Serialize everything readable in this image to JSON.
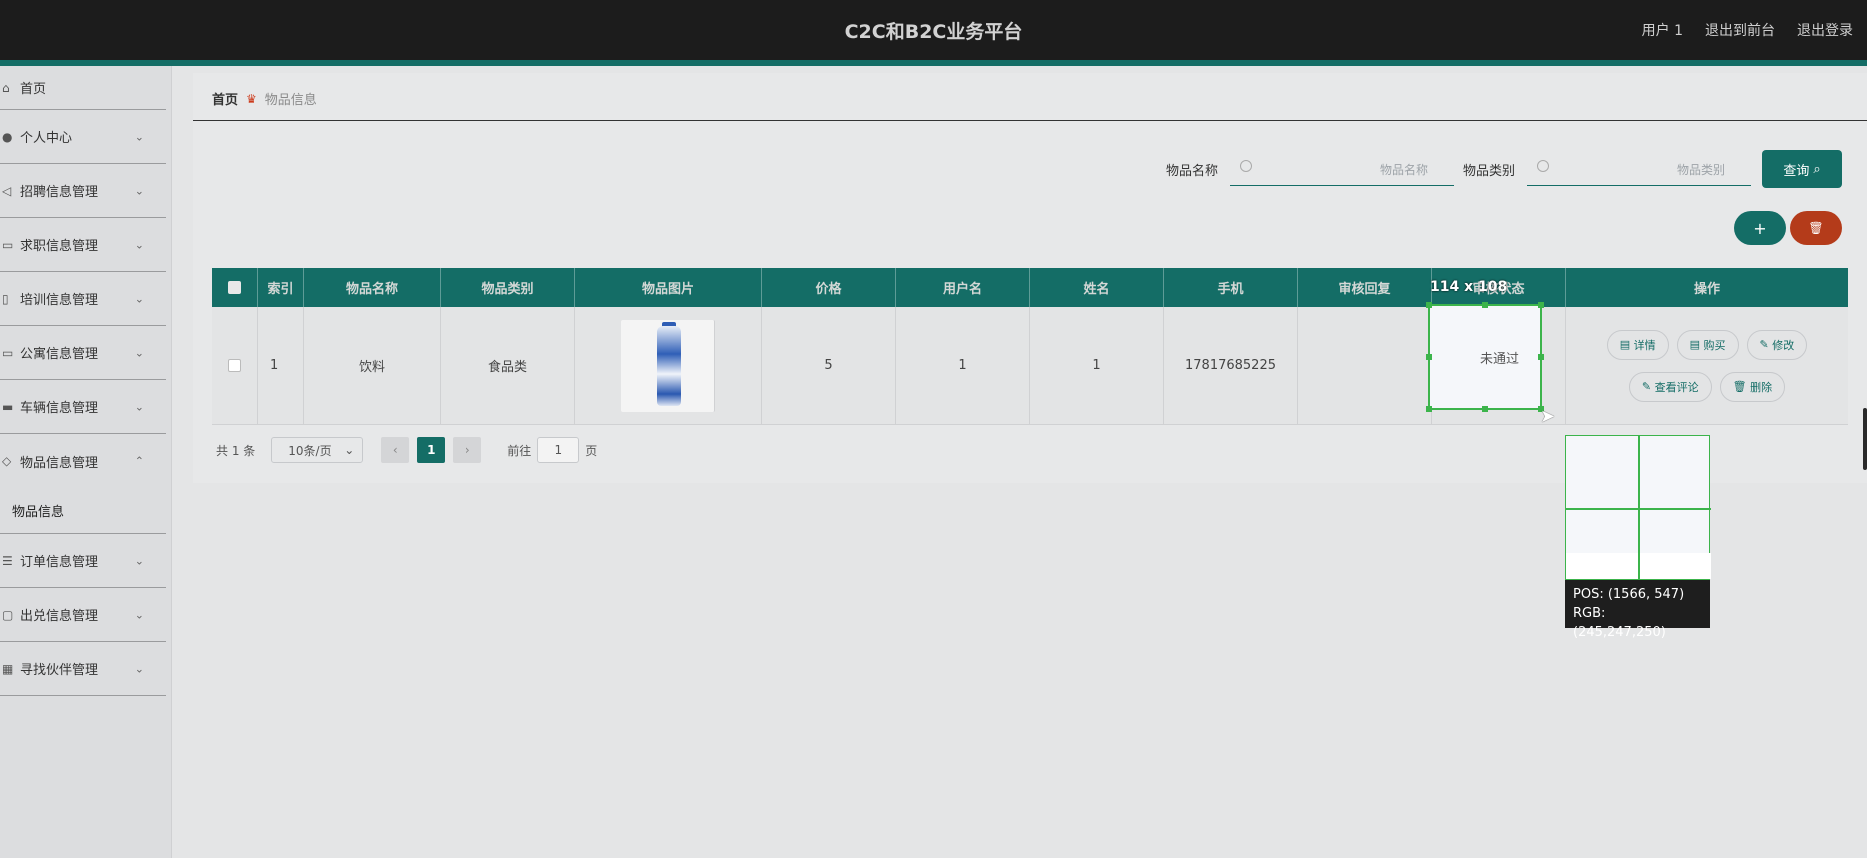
{
  "header": {
    "title": "C2C和B2C业务平台",
    "user": "用户 1",
    "to_front": "退出到前台",
    "logout": "退出登录"
  },
  "sidebar": {
    "items": [
      {
        "label": "首页",
        "icon": "home-icon"
      },
      {
        "label": "个人中心",
        "icon": "user-icon"
      },
      {
        "label": "招聘信息管理",
        "icon": "send-icon"
      },
      {
        "label": "求职信息管理",
        "icon": "folder-icon"
      },
      {
        "label": "培训信息管理",
        "icon": "document-icon"
      },
      {
        "label": "公寓信息管理",
        "icon": "building-icon"
      },
      {
        "label": "车辆信息管理",
        "icon": "car-icon"
      },
      {
        "label": "物品信息管理",
        "icon": "box-icon"
      },
      {
        "label": "订单信息管理",
        "icon": "list-icon"
      },
      {
        "label": "出兑信息管理",
        "icon": "chat-icon"
      },
      {
        "label": "寻找伙伴管理",
        "icon": "grid-icon"
      }
    ],
    "sub_item": "物品信息"
  },
  "breadcrumb": {
    "home": "首页",
    "current": "物品信息"
  },
  "search": {
    "name_label": "物品名称",
    "name_placeholder": "物品名称",
    "cat_label": "物品类别",
    "cat_placeholder": "物品类别",
    "query_label": "查询"
  },
  "table": {
    "headers": [
      "索引",
      "物品名称",
      "物品类别",
      "物品图片",
      "价格",
      "用户名",
      "姓名",
      "手机",
      "审核回复",
      "审核状态",
      "操作"
    ],
    "rows": [
      {
        "index": "1",
        "name": "饮料",
        "category": "食品类",
        "price": "5",
        "username": "1",
        "realname": "1",
        "phone": "17817685225",
        "reply": "",
        "status": "未通过"
      }
    ],
    "actions": {
      "detail": "详情",
      "buy": "购买",
      "edit": "修改",
      "comments": "查看评论",
      "delete": "删除"
    }
  },
  "pager": {
    "total": "共 1 条",
    "size": "10条/页",
    "page": "1",
    "goto_prefix": "前往",
    "goto_value": "1",
    "goto_suffix": "页"
  },
  "overlay": {
    "dims": "114 x 108",
    "pos": "POS:  (1566, 547)",
    "rgb": "RGB:  (245,247,250)"
  },
  "colors": {
    "brand": "#146d66",
    "danger": "#b43b1a",
    "topbar": "#1c1c1c"
  }
}
